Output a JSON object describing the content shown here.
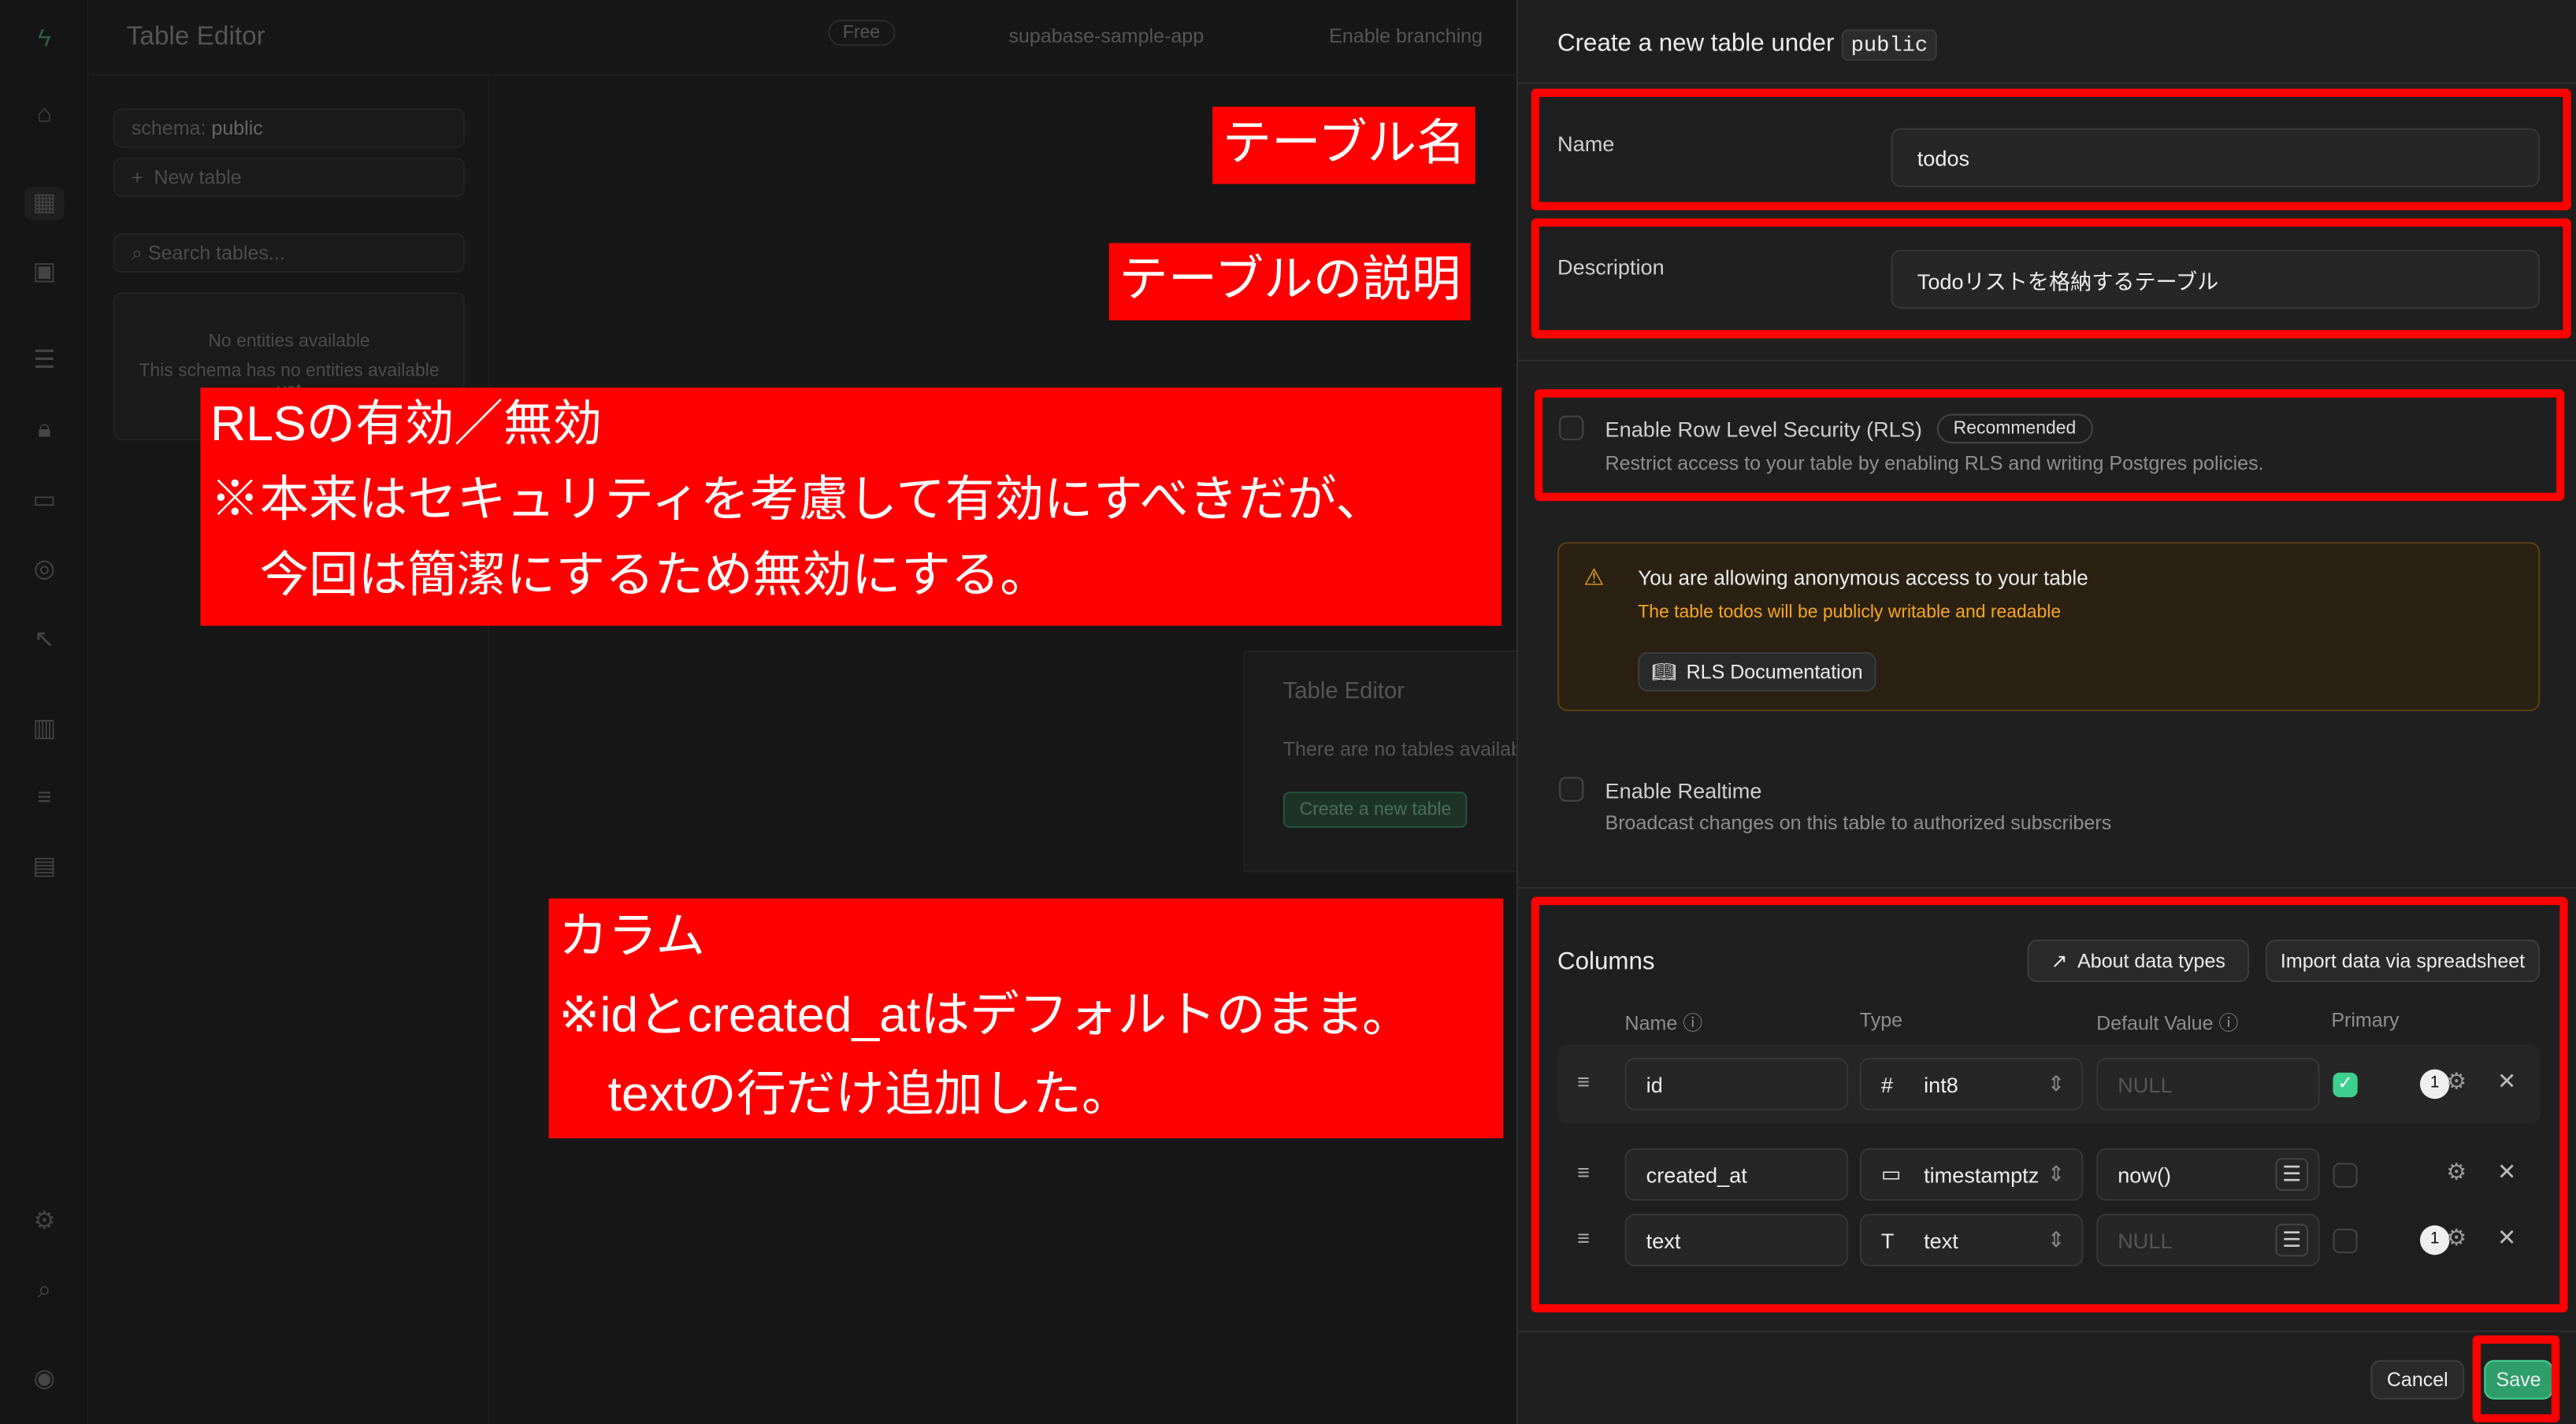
{
  "topbar": {
    "title": "Table Editor",
    "plan": "Free",
    "project": "supabase-sample-app",
    "branching": "Enable branching"
  },
  "sidebar": {
    "schema_label": "schema:",
    "schema_value": "public",
    "new_table": "New table",
    "search_placeholder": "Search tables...",
    "empty_title": "No entities available",
    "empty_desc": "This schema has no entities available yet"
  },
  "main": {
    "card_title": "Table Editor",
    "card_desc": "There are no tables available",
    "card_button": "Create a new table"
  },
  "panel": {
    "title": "Create a new table under",
    "schema": "public",
    "name_label": "Name",
    "name_value": "todos",
    "desc_label": "Description",
    "desc_value": "Todoリストを格納するテーブル",
    "rls_label": "Enable Row Level Security (RLS)",
    "rls_badge": "Recommended",
    "rls_desc": "Restrict access to your table by enabling RLS and writing Postgres policies.",
    "rls_enabled": false,
    "warn_title": "You are allowing anonymous access to your table",
    "warn_desc": "The table todos will be publicly writable and readable",
    "warn_button": "RLS Documentation",
    "realtime_label": "Enable Realtime",
    "realtime_desc": "Broadcast changes on this table to authorized subscribers",
    "realtime_enabled": false,
    "columns_title": "Columns",
    "about_types": "About data types",
    "import": "Import data via spreadsheet",
    "col_headers": {
      "name": "Name",
      "type": "Type",
      "default": "Default Value",
      "primary": "Primary"
    },
    "columns": [
      {
        "name": "id",
        "type": "int8",
        "type_icon": "hash-icon",
        "default": "NULL",
        "default_is_placeholder": true,
        "primary": true,
        "badge": "1"
      },
      {
        "name": "created_at",
        "type": "timestamptz",
        "type_icon": "calendar-icon",
        "default": "now()",
        "default_is_placeholder": false,
        "primary": false,
        "badge": ""
      },
      {
        "name": "text",
        "type": "text",
        "type_icon": "text-icon",
        "default": "NULL",
        "default_is_placeholder": true,
        "primary": false,
        "badge": "1"
      }
    ],
    "cancel": "Cancel",
    "save": "Save"
  },
  "annotations": {
    "name": "テーブル名",
    "desc": "テーブルの説明",
    "rls": "RLSの有効／無効\n※本来はセキュリティを考慮して有効にすべきだが、\n　今回は簡潔にするため無効にする。",
    "columns": "カラム\n※idとcreated_atはデフォルトのまま。\n　textの行だけ追加した。"
  },
  "colors": {
    "accent": "#3ecf8e",
    "save": "#2f9e6b",
    "annotation": "#ff0000",
    "warning": "#f5a623"
  }
}
